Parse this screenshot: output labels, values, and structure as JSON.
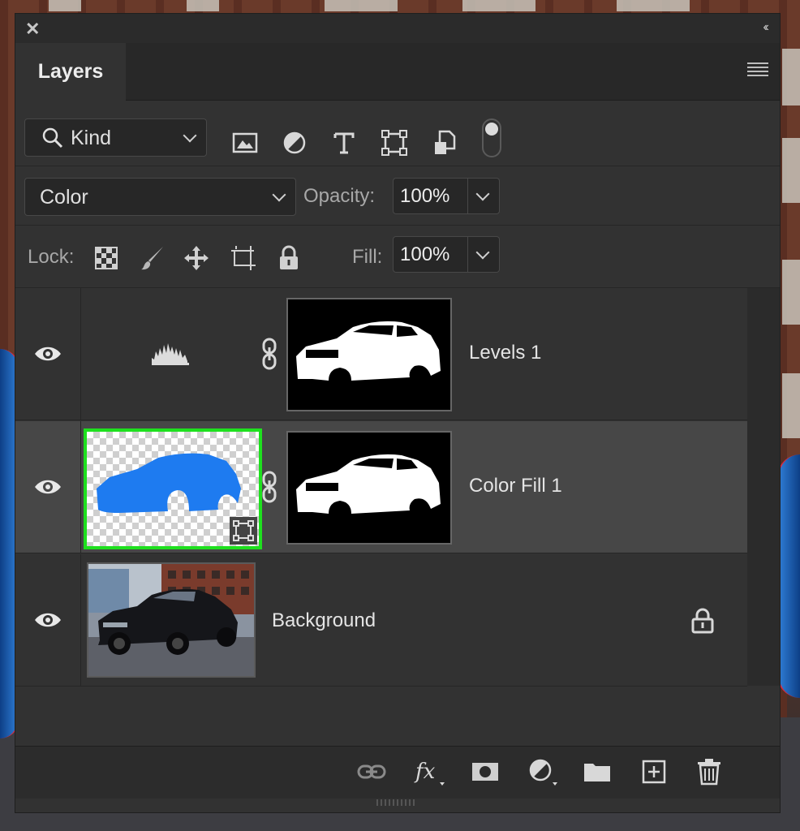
{
  "panel": {
    "title": "Layers"
  },
  "filter": {
    "kind_label": "Kind",
    "icons": [
      "pixel-layer-filter-icon",
      "adjustment-layer-filter-icon",
      "type-layer-filter-icon",
      "shape-layer-filter-icon",
      "smart-object-filter-icon"
    ]
  },
  "blend": {
    "mode": "Color",
    "opacity_label": "Opacity:",
    "opacity_value": "100%"
  },
  "lock": {
    "label": "Lock:",
    "fill_label": "Fill:",
    "fill_value": "100%"
  },
  "layers": [
    {
      "name": "Levels 1",
      "visible": true,
      "selected": false,
      "type": "adjustment-levels"
    },
    {
      "name": "Color Fill 1",
      "visible": true,
      "selected": true,
      "type": "fill",
      "fill_color": "#1e7bf0"
    },
    {
      "name": "Background",
      "visible": true,
      "selected": false,
      "type": "image",
      "locked": true
    }
  ],
  "colors": {
    "selection_outline": "#1ee01e",
    "fill_blue": "#1e7bf0",
    "panel_bg": "#323232"
  }
}
